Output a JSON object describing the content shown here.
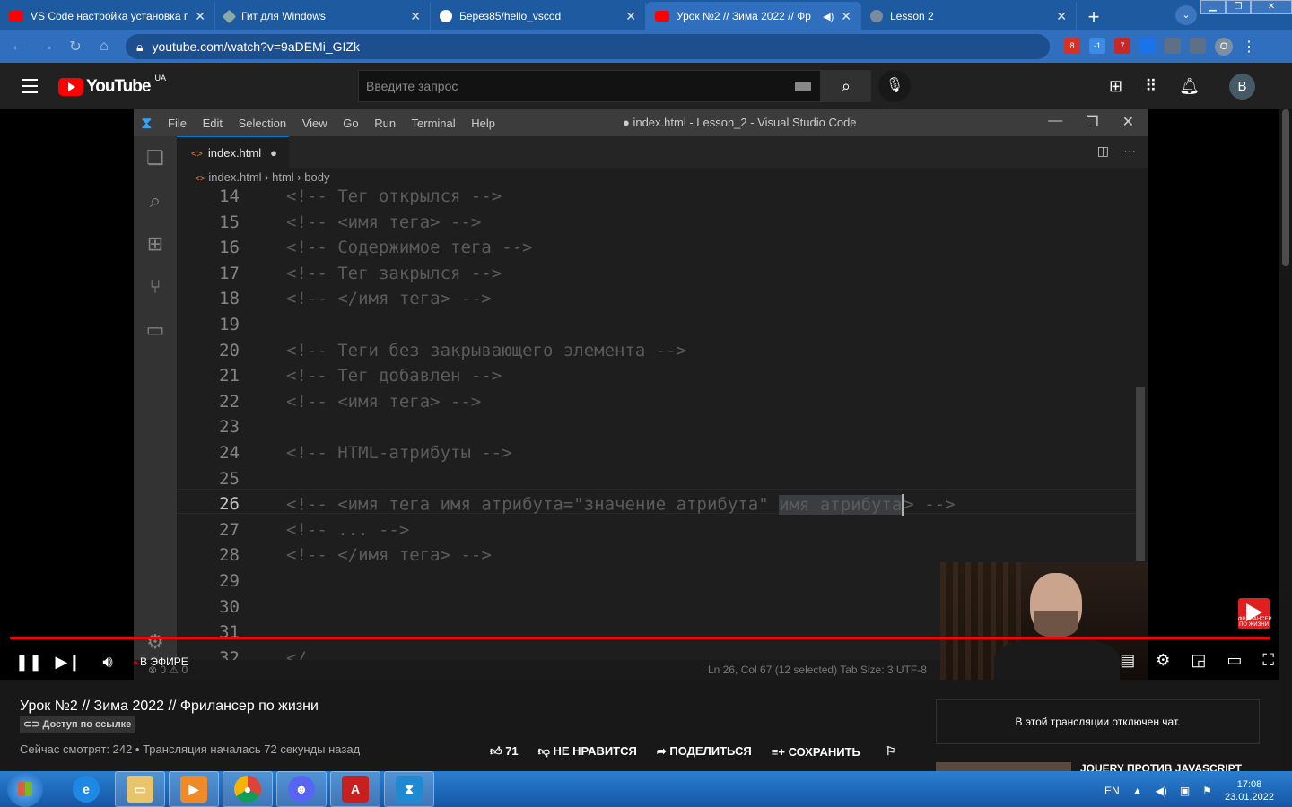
{
  "browser": {
    "tabs": [
      {
        "title": "VS Code настройка установка п",
        "icon": "youtube-icon",
        "active": false
      },
      {
        "title": "Гит для Windows",
        "icon": "git-icon",
        "active": false
      },
      {
        "title": "Берез85/hello_vscod",
        "icon": "github-icon",
        "active": false
      },
      {
        "title": "Урок №2 // Зима 2022 // Фр",
        "icon": "youtube-icon",
        "active": true
      },
      {
        "title": "Lesson 2",
        "icon": "globe-icon",
        "active": false
      }
    ],
    "url": "youtube.com/watch?v=9aDEMi_GIZk",
    "ext_badges": [
      "8",
      "-1",
      "7"
    ],
    "profile_initial": "O"
  },
  "youtube": {
    "logo_text": "YouTube",
    "region": "UA",
    "search_placeholder": "Введите запрос",
    "avatar_initial": "B"
  },
  "vscode": {
    "menu": [
      "File",
      "Edit",
      "Selection",
      "View",
      "Go",
      "Run",
      "Terminal",
      "Help"
    ],
    "window_title": "● index.html - Lesson_2 - Visual Studio Code",
    "tab_label": "index.html",
    "breadcrumb": [
      "index.html",
      "html",
      "body"
    ],
    "lines": [
      {
        "n": "14",
        "text": "<!-- Тег открылся -->"
      },
      {
        "n": "15",
        "text": "<!-- <имя тега> -->"
      },
      {
        "n": "16",
        "text": "<!-- Содержимое тега -->"
      },
      {
        "n": "17",
        "text": "<!-- Тег закрылся -->"
      },
      {
        "n": "18",
        "text": "<!-- </имя тега> -->"
      },
      {
        "n": "19",
        "text": ""
      },
      {
        "n": "20",
        "text": "<!-- Теги без закрывающего элемента -->"
      },
      {
        "n": "21",
        "text": "<!-- Тег добавлен -->"
      },
      {
        "n": "22",
        "text": "<!-- <имя тега> -->"
      },
      {
        "n": "23",
        "text": ""
      },
      {
        "n": "24",
        "text": "<!-- HTML-атрибуты -->"
      },
      {
        "n": "25",
        "text": ""
      },
      {
        "n": "26",
        "text": "<!-- <имя тега имя атрибута=\"значение атрибута\" имя атрибута> -->"
      },
      {
        "n": "27",
        "text": "<!-- ... -->"
      },
      {
        "n": "28",
        "text": "<!-- </имя тега> -->"
      },
      {
        "n": "29",
        "text": ""
      },
      {
        "n": "30",
        "text": ""
      },
      {
        "n": "31",
        "text": ""
      },
      {
        "n": "32",
        "text": "</"
      }
    ],
    "line26": {
      "before": "<!-- <имя тега имя атрибута=\"значение атрибута\" ",
      "selected": "имя атрибута",
      "after": "> -->"
    },
    "status_left": "⊗ 0 ⚠ 0",
    "status_right": "Ln 26, Col 67 (12 selected)    Tab Size: 3    UTF-8"
  },
  "player": {
    "live_label": "В ЭФИРЕ",
    "channel_badge": "ФРИЛАНСЕР ПО ЖИЗНИ",
    "progress_fraction": 1.0
  },
  "video": {
    "title": "Урок №2 // Зима 2022 // Фрилансер по жизни",
    "access": "Доступ по ссылке",
    "meta": "Сейчас смотрят: 242 • Трансляция началась 72 секунды назад",
    "likes": "71",
    "dislike_label": "НЕ НРАВИТСЯ",
    "share_label": "ПОДЕЛИТЬСЯ",
    "save_label": "СОХРАНИТЬ",
    "chat_notice": "В этой трансляции отключен чат.",
    "related_title": "JQUERY ПРОТИВ JAVASCRIPT"
  },
  "taskbar": {
    "lang": "EN",
    "time": "17:08",
    "date": "23.01.2022"
  }
}
